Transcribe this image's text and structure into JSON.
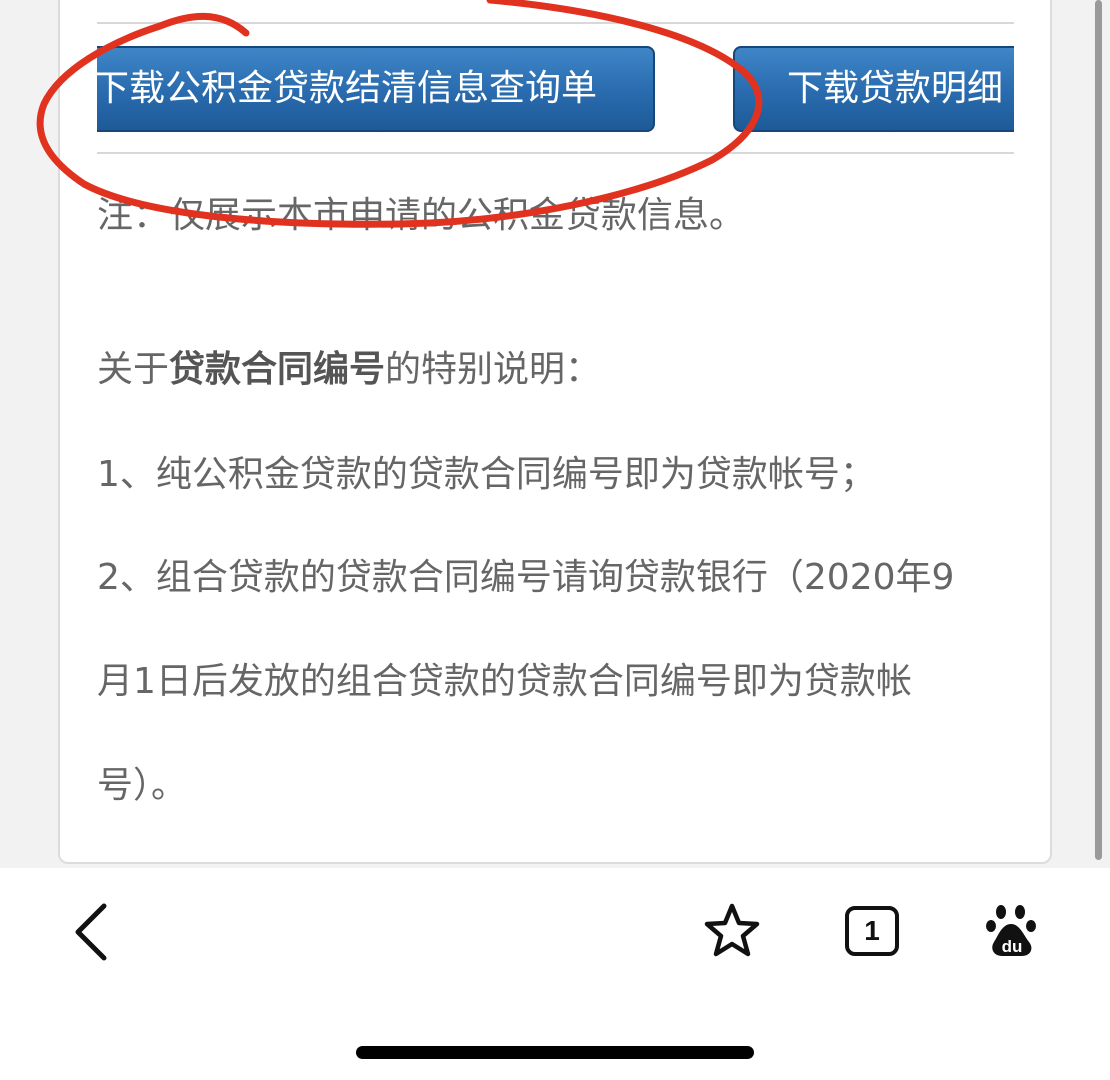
{
  "buttons": {
    "download_clearance": "下载公积金贷款结清信息查询单",
    "download_detail": "下载贷款明细"
  },
  "note": "注：仅展示本市申请的公积金贷款信息。",
  "special_note": {
    "prefix": "关于",
    "bold": "贷款合同编号",
    "suffix": "的特别说明："
  },
  "items": [
    "1、纯公积金贷款的贷款合同编号即为贷款帐号；",
    "2、组合贷款的贷款合同编号请询贷款银行（2020年9",
    "月1日后发放的组合贷款的贷款合同编号即为贷款帐",
    "号）。"
  ],
  "browser_bar": {
    "back_icon": "chevron-left-icon",
    "favorite_icon": "star-icon",
    "tabs_count": "1",
    "baidu_icon": "baidu-paw-icon"
  },
  "colors": {
    "button_blue": "#2a6db0",
    "annotation_red": "#e0321f",
    "text_gray": "#666666"
  }
}
